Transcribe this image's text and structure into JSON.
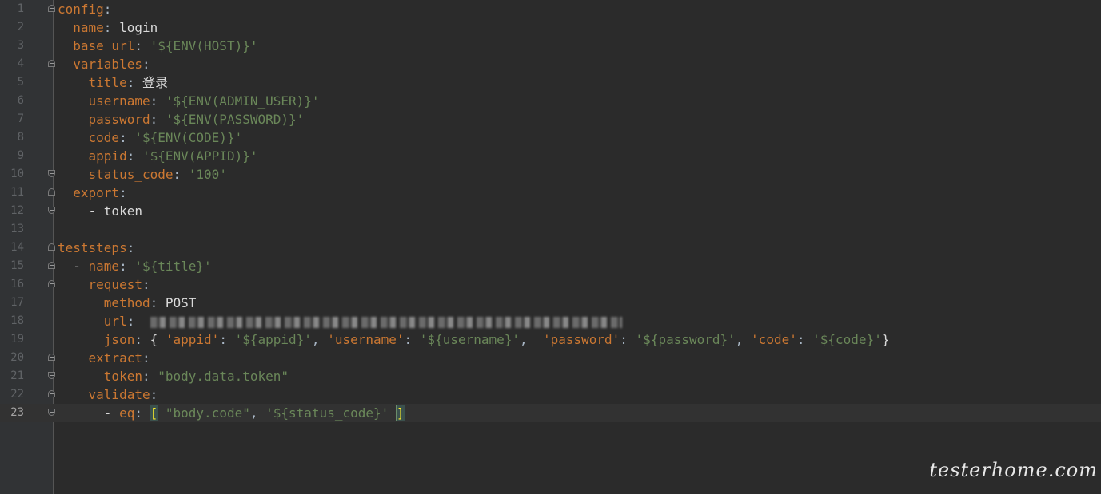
{
  "editor": {
    "line_numbers": [
      "1",
      "2",
      "3",
      "4",
      "5",
      "6",
      "7",
      "8",
      "9",
      "10",
      "11",
      "12",
      "13",
      "14",
      "15",
      "16",
      "17",
      "18",
      "19",
      "20",
      "21",
      "22",
      "23"
    ],
    "l1_key": "config",
    "colon": ":",
    "l2_key": "name",
    "l2_val": "login",
    "l3_key": "base_url",
    "l3_val": "'${ENV(HOST)}'",
    "l4_key": "variables",
    "l5_key": "title",
    "l5_val": "登录",
    "l6_key": "username",
    "l6_val": "'${ENV(ADMIN_USER)}'",
    "l7_key": "password",
    "l7_val": "'${ENV(PASSWORD)}'",
    "l8_key": "code",
    "l8_val": "'${ENV(CODE)}'",
    "l9_key": "appid",
    "l9_val": "'${ENV(APPID)}'",
    "l10_key": "status_code",
    "l10_val": "'100'",
    "l11_key": "export",
    "l12_dash": "- ",
    "l12_val": "token",
    "l14_key": "teststeps",
    "l15_key": "name",
    "l15_val": "'${title}'",
    "l16_key": "request",
    "l17_key": "method",
    "l17_val": "POST",
    "l18_key": "url",
    "l19_key": "json",
    "l19_open": "{ ",
    "l19_k1": "'appid'",
    "l19_v1": "'${appid}'",
    "l19_k2": "'username'",
    "l19_v2": "'${username}'",
    "l19_k3": "'password'",
    "l19_v3": "'${password}'",
    "l19_k4": "'code'",
    "l19_v4": "'${code}'",
    "l19_close": "}",
    "comma": ", ",
    "l20_key": "extract",
    "l21_key": "token",
    "l21_val": "\"body.data.token\"",
    "l22_key": "validate",
    "l23_key": "eq",
    "l23_open": "[",
    "l23_v1": "\"body.code\"",
    "l23_v2": "'${status_code}'",
    "l23_close": "]"
  },
  "watermark": "testerhome.com"
}
